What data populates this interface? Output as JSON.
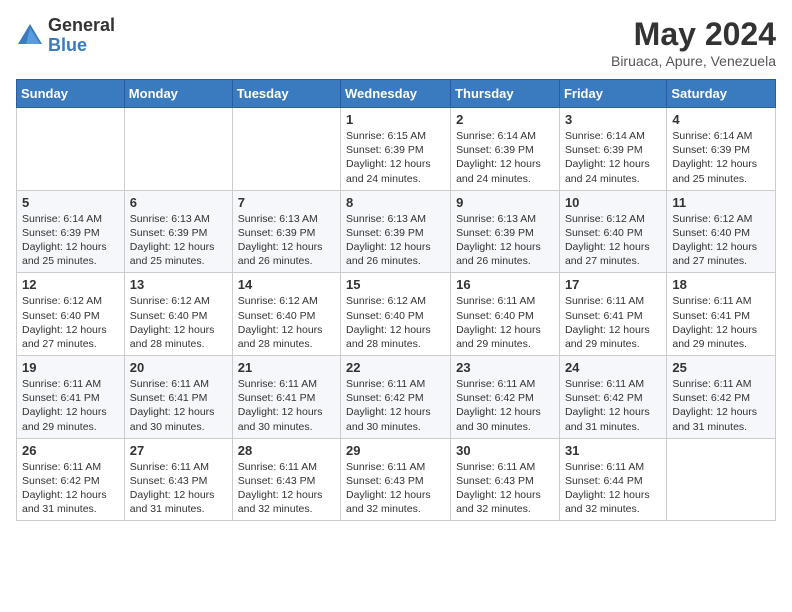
{
  "header": {
    "logo_general": "General",
    "logo_blue": "Blue",
    "month_year": "May 2024",
    "location": "Biruaca, Apure, Venezuela"
  },
  "days_of_week": [
    "Sunday",
    "Monday",
    "Tuesday",
    "Wednesday",
    "Thursday",
    "Friday",
    "Saturday"
  ],
  "weeks": [
    [
      {
        "day": "",
        "info": ""
      },
      {
        "day": "",
        "info": ""
      },
      {
        "day": "",
        "info": ""
      },
      {
        "day": "1",
        "info": "Sunrise: 6:15 AM\nSunset: 6:39 PM\nDaylight: 12 hours and 24 minutes."
      },
      {
        "day": "2",
        "info": "Sunrise: 6:14 AM\nSunset: 6:39 PM\nDaylight: 12 hours and 24 minutes."
      },
      {
        "day": "3",
        "info": "Sunrise: 6:14 AM\nSunset: 6:39 PM\nDaylight: 12 hours and 24 minutes."
      },
      {
        "day": "4",
        "info": "Sunrise: 6:14 AM\nSunset: 6:39 PM\nDaylight: 12 hours and 25 minutes."
      }
    ],
    [
      {
        "day": "5",
        "info": "Sunrise: 6:14 AM\nSunset: 6:39 PM\nDaylight: 12 hours and 25 minutes."
      },
      {
        "day": "6",
        "info": "Sunrise: 6:13 AM\nSunset: 6:39 PM\nDaylight: 12 hours and 25 minutes."
      },
      {
        "day": "7",
        "info": "Sunrise: 6:13 AM\nSunset: 6:39 PM\nDaylight: 12 hours and 26 minutes."
      },
      {
        "day": "8",
        "info": "Sunrise: 6:13 AM\nSunset: 6:39 PM\nDaylight: 12 hours and 26 minutes."
      },
      {
        "day": "9",
        "info": "Sunrise: 6:13 AM\nSunset: 6:39 PM\nDaylight: 12 hours and 26 minutes."
      },
      {
        "day": "10",
        "info": "Sunrise: 6:12 AM\nSunset: 6:40 PM\nDaylight: 12 hours and 27 minutes."
      },
      {
        "day": "11",
        "info": "Sunrise: 6:12 AM\nSunset: 6:40 PM\nDaylight: 12 hours and 27 minutes."
      }
    ],
    [
      {
        "day": "12",
        "info": "Sunrise: 6:12 AM\nSunset: 6:40 PM\nDaylight: 12 hours and 27 minutes."
      },
      {
        "day": "13",
        "info": "Sunrise: 6:12 AM\nSunset: 6:40 PM\nDaylight: 12 hours and 28 minutes."
      },
      {
        "day": "14",
        "info": "Sunrise: 6:12 AM\nSunset: 6:40 PM\nDaylight: 12 hours and 28 minutes."
      },
      {
        "day": "15",
        "info": "Sunrise: 6:12 AM\nSunset: 6:40 PM\nDaylight: 12 hours and 28 minutes."
      },
      {
        "day": "16",
        "info": "Sunrise: 6:11 AM\nSunset: 6:40 PM\nDaylight: 12 hours and 29 minutes."
      },
      {
        "day": "17",
        "info": "Sunrise: 6:11 AM\nSunset: 6:41 PM\nDaylight: 12 hours and 29 minutes."
      },
      {
        "day": "18",
        "info": "Sunrise: 6:11 AM\nSunset: 6:41 PM\nDaylight: 12 hours and 29 minutes."
      }
    ],
    [
      {
        "day": "19",
        "info": "Sunrise: 6:11 AM\nSunset: 6:41 PM\nDaylight: 12 hours and 29 minutes."
      },
      {
        "day": "20",
        "info": "Sunrise: 6:11 AM\nSunset: 6:41 PM\nDaylight: 12 hours and 30 minutes."
      },
      {
        "day": "21",
        "info": "Sunrise: 6:11 AM\nSunset: 6:41 PM\nDaylight: 12 hours and 30 minutes."
      },
      {
        "day": "22",
        "info": "Sunrise: 6:11 AM\nSunset: 6:42 PM\nDaylight: 12 hours and 30 minutes."
      },
      {
        "day": "23",
        "info": "Sunrise: 6:11 AM\nSunset: 6:42 PM\nDaylight: 12 hours and 30 minutes."
      },
      {
        "day": "24",
        "info": "Sunrise: 6:11 AM\nSunset: 6:42 PM\nDaylight: 12 hours and 31 minutes."
      },
      {
        "day": "25",
        "info": "Sunrise: 6:11 AM\nSunset: 6:42 PM\nDaylight: 12 hours and 31 minutes."
      }
    ],
    [
      {
        "day": "26",
        "info": "Sunrise: 6:11 AM\nSunset: 6:42 PM\nDaylight: 12 hours and 31 minutes."
      },
      {
        "day": "27",
        "info": "Sunrise: 6:11 AM\nSunset: 6:43 PM\nDaylight: 12 hours and 31 minutes."
      },
      {
        "day": "28",
        "info": "Sunrise: 6:11 AM\nSunset: 6:43 PM\nDaylight: 12 hours and 32 minutes."
      },
      {
        "day": "29",
        "info": "Sunrise: 6:11 AM\nSunset: 6:43 PM\nDaylight: 12 hours and 32 minutes."
      },
      {
        "day": "30",
        "info": "Sunrise: 6:11 AM\nSunset: 6:43 PM\nDaylight: 12 hours and 32 minutes."
      },
      {
        "day": "31",
        "info": "Sunrise: 6:11 AM\nSunset: 6:44 PM\nDaylight: 12 hours and 32 minutes."
      },
      {
        "day": "",
        "info": ""
      }
    ]
  ]
}
